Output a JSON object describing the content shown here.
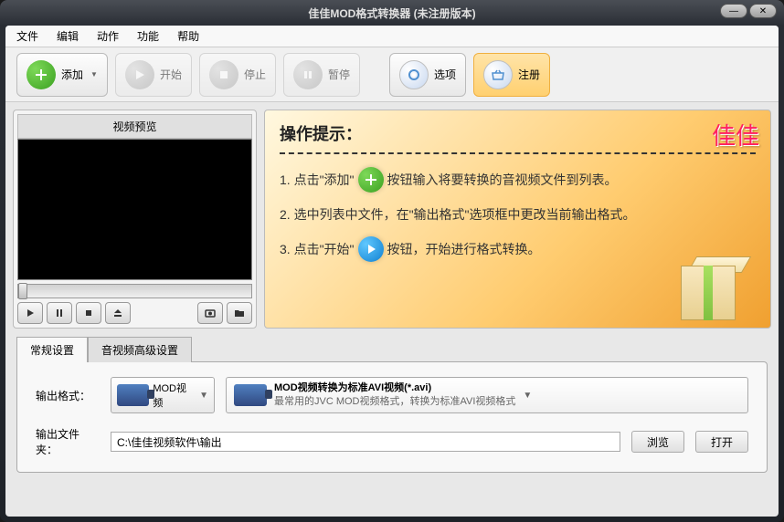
{
  "titlebar": {
    "title": "佳佳MOD格式转换器   (未注册版本)"
  },
  "menu": {
    "file": "文件",
    "edit": "编辑",
    "action": "动作",
    "function": "功能",
    "help": "帮助"
  },
  "toolbar": {
    "add": "添加",
    "start": "开始",
    "stop": "停止",
    "pause": "暂停",
    "options": "选项",
    "register": "注册"
  },
  "preview": {
    "title": "视频预览"
  },
  "instructions": {
    "title": "操作提示：",
    "brand": "佳佳",
    "step1_a": "1. 点击\"添加\"",
    "step1_b": "按钮输入将要转换的音视频文件到列表。",
    "step2": "2. 选中列表中文件，在\"输出格式\"选项框中更改当前输出格式。",
    "step3_a": "3. 点击\"开始\"",
    "step3_b": "按钮，开始进行格式转换。"
  },
  "tabs": {
    "general": "常规设置",
    "advanced": "音视频高级设置"
  },
  "settings": {
    "output_format_label": "输出格式：",
    "format_name": "MOD视频",
    "format_title": "MOD视频转换为标准AVI视频(*.avi)",
    "format_desc": "最常用的JVC MOD视频格式，转换为标准AVI视频格式",
    "output_folder_label": "输出文件夹：",
    "output_path": "C:\\佳佳视频软件\\输出",
    "browse": "浏览",
    "open": "打开"
  }
}
